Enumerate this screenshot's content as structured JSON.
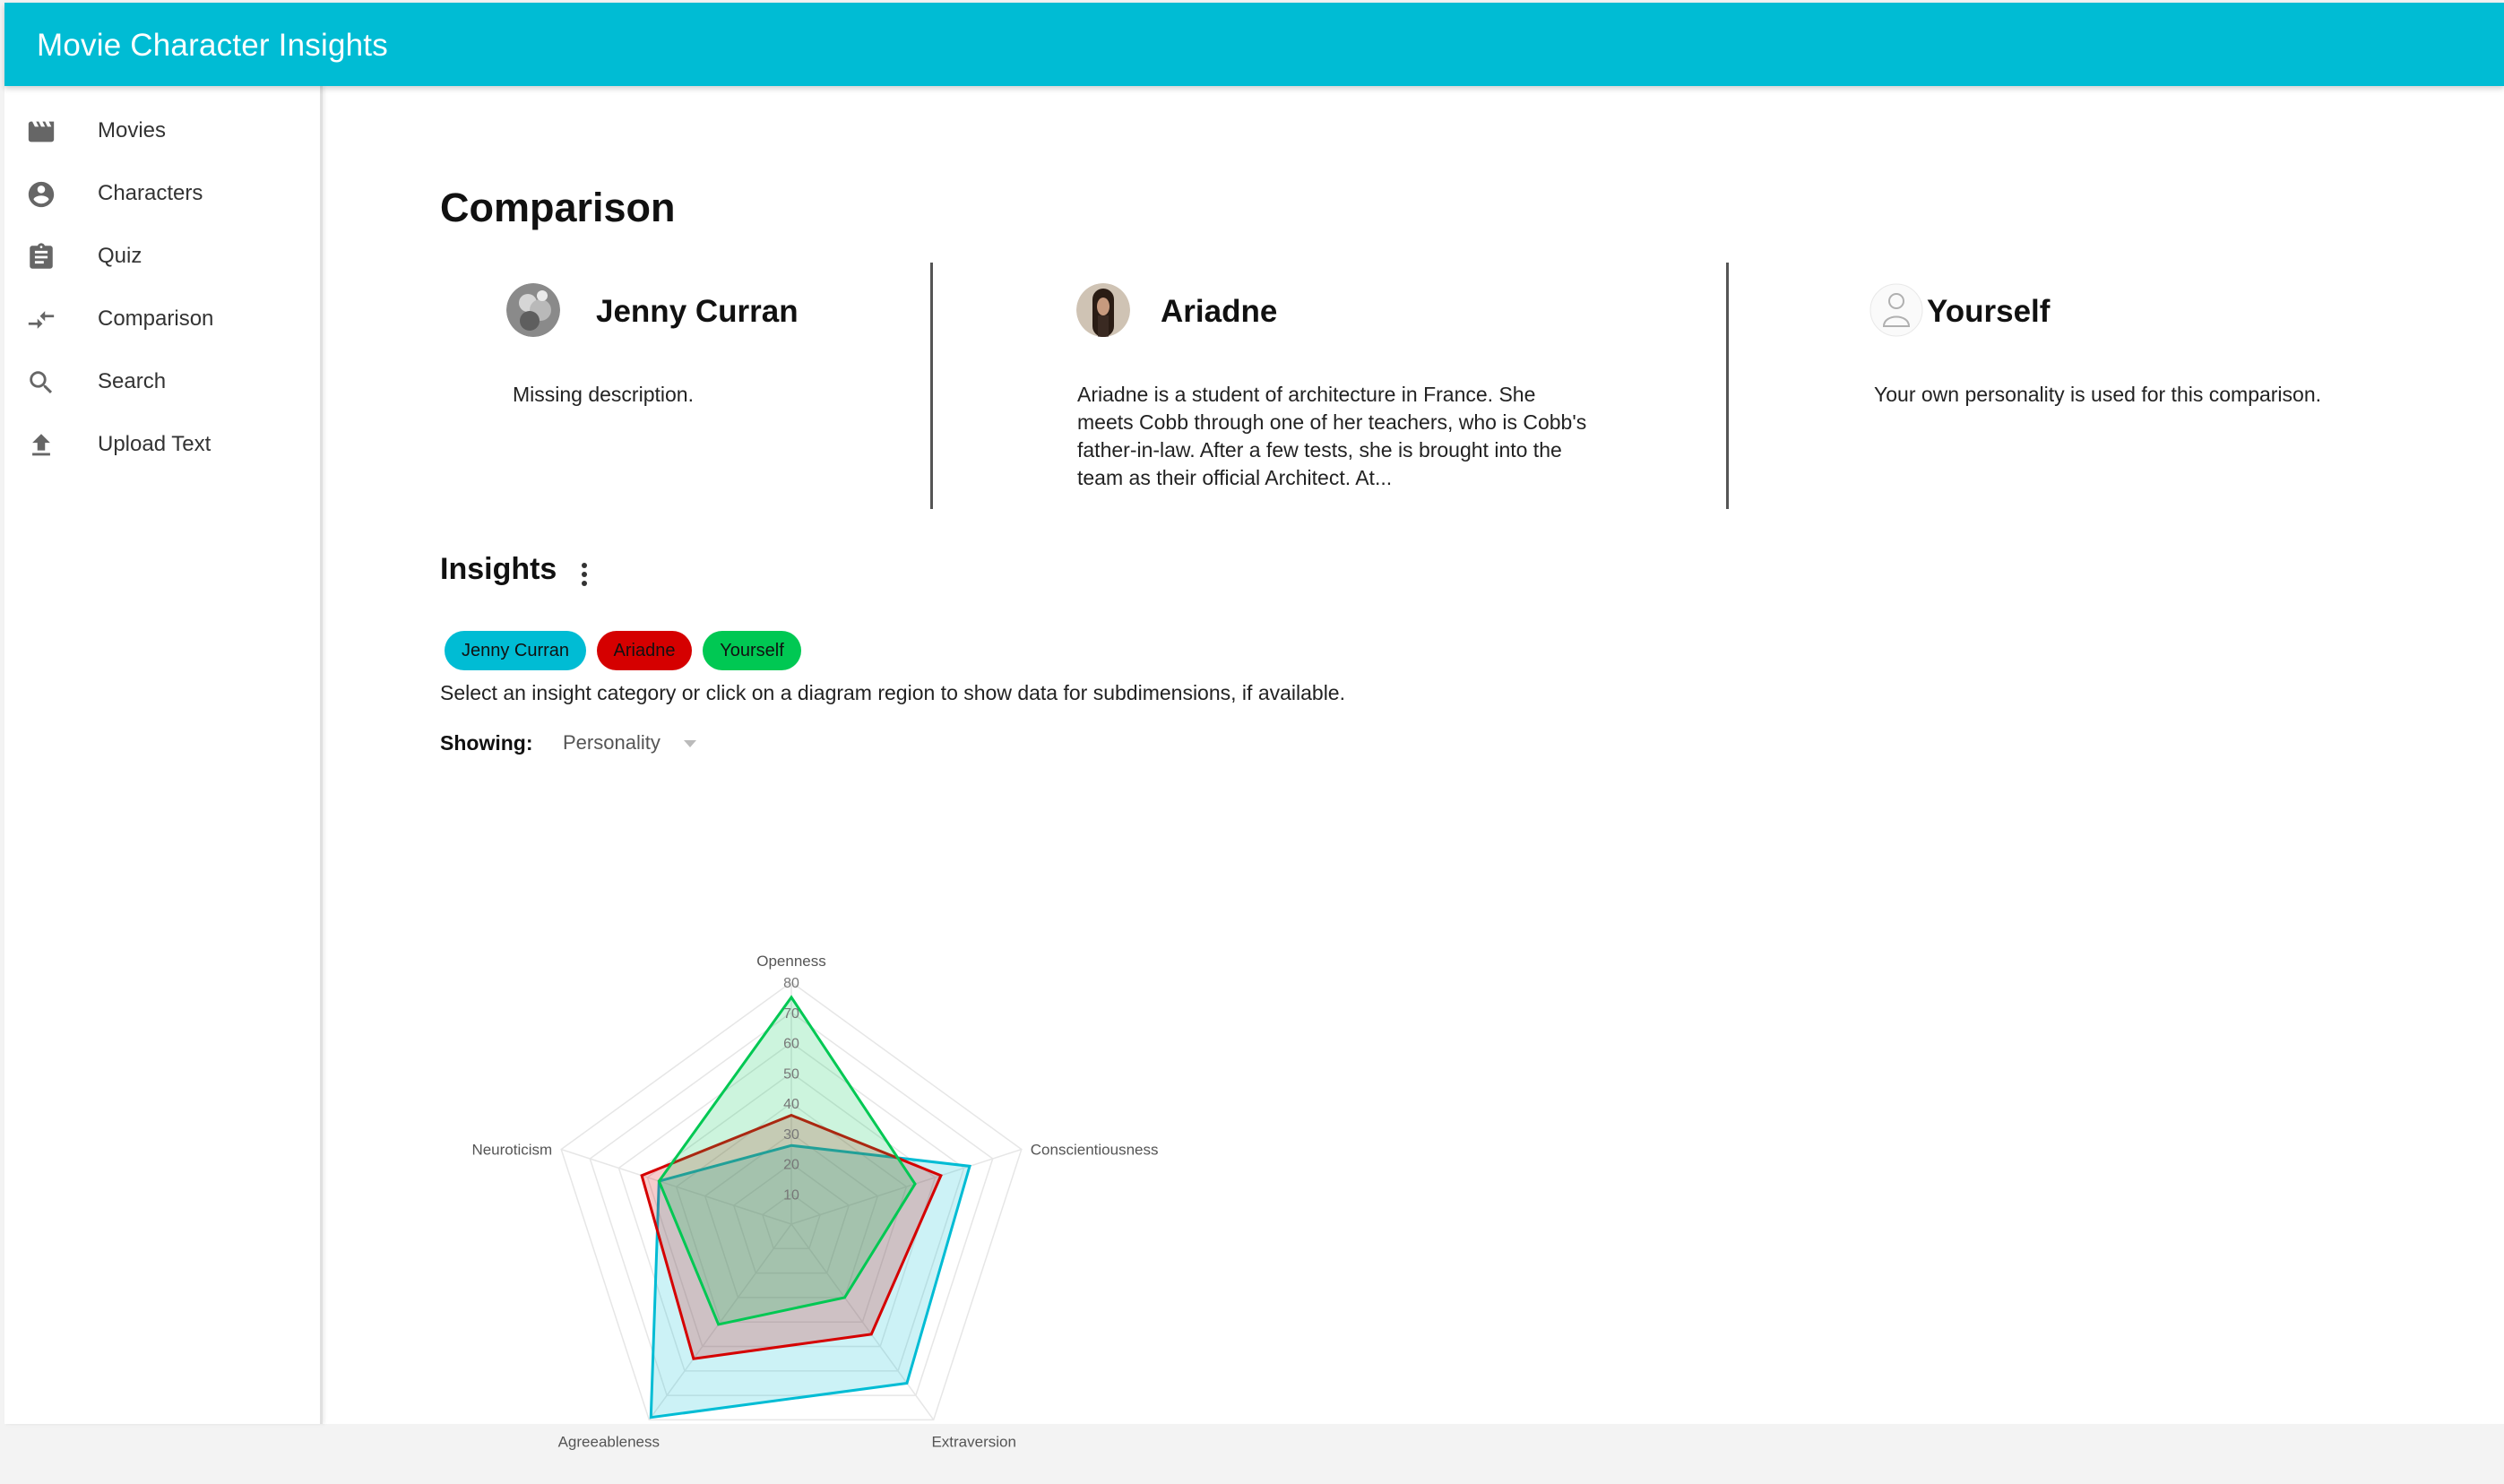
{
  "app": {
    "title": "Movie Character Insights"
  },
  "sidebar": {
    "items": [
      {
        "label": "Movies",
        "icon": "movie-icon"
      },
      {
        "label": "Characters",
        "icon": "account-circle-icon"
      },
      {
        "label": "Quiz",
        "icon": "clipboard-icon"
      },
      {
        "label": "Comparison",
        "icon": "compare-arrows-icon"
      },
      {
        "label": "Search",
        "icon": "search-icon"
      },
      {
        "label": "Upload Text",
        "icon": "upload-icon"
      }
    ]
  },
  "page": {
    "title": "Comparison"
  },
  "cards": [
    {
      "name": "Jenny Curran",
      "description": "Missing description.",
      "avatar": "character-photo"
    },
    {
      "name": "Ariadne",
      "description": "Ariadne is a student of architecture in France. She meets Cobb through one of her teachers, who is Cobb's father-in-law. After a few tests, she is brought into the team as their official Architect. At...",
      "avatar": "character-photo"
    },
    {
      "name": "Yourself",
      "description": "Your own personality is used for this comparison.",
      "avatar": "person-outline-icon"
    }
  ],
  "insights": {
    "title": "Insights",
    "menu_icon": "more-vert-icon",
    "chips": [
      {
        "label": "Jenny Curran",
        "color": "#00bcd4"
      },
      {
        "label": "Ariadne",
        "color": "#d50000"
      },
      {
        "label": "Yourself",
        "color": "#00c853"
      }
    ],
    "hint": "Select an insight category or click on a diagram region to show data for subdimensions, if available.",
    "showing_label": "Showing:",
    "showing_value": "Personality"
  },
  "colors": {
    "primary": "#00bcd4",
    "jenny": "#00bcd4",
    "ariadne": "#d50000",
    "yourself": "#00c853"
  },
  "chart_data": {
    "type": "radar",
    "categories": [
      "Openness",
      "Conscientiousness",
      "Extraversion",
      "Agreeableness",
      "Neuroticism"
    ],
    "scale_max": 80,
    "ticks": [
      10,
      20,
      30,
      40,
      50,
      60,
      70,
      80
    ],
    "series": [
      {
        "name": "Jenny Curran",
        "color": "#00bcd4",
        "values": [
          26,
          62,
          65,
          79,
          46
        ]
      },
      {
        "name": "Ariadne",
        "color": "#d50000",
        "values": [
          36,
          52,
          45,
          55,
          52
        ]
      },
      {
        "name": "Yourself",
        "color": "#00c853",
        "values": [
          75,
          43,
          30,
          41,
          46
        ]
      }
    ]
  }
}
